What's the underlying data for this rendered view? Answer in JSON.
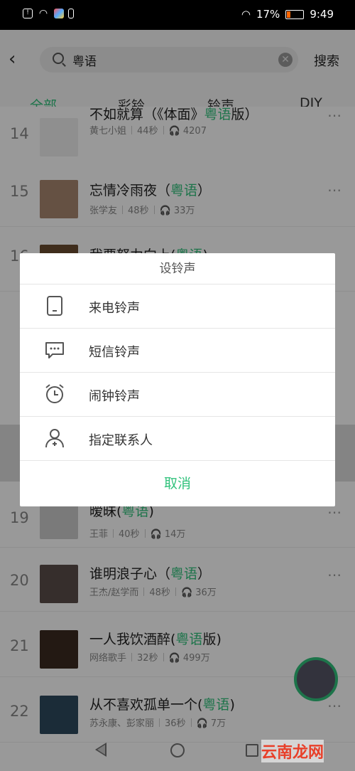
{
  "status_bar": {
    "battery": "17%",
    "time": "9:49"
  },
  "search": {
    "query": "粤语",
    "button": "搜索"
  },
  "tabs": [
    "全部",
    "彩铃",
    "铃声",
    "DIY"
  ],
  "songs": [
    {
      "rank": "14",
      "title_pre": "不如就算（《体面》",
      "title_hl": "粤语",
      "title_post": "版）",
      "artist": "黄七小姐",
      "duration": "44秒",
      "plays": "4207"
    },
    {
      "rank": "15",
      "title_pre": "忘情冷雨夜（",
      "title_hl": "粤语",
      "title_post": "）",
      "artist": "张学友",
      "duration": "48秒",
      "plays": "33万"
    },
    {
      "rank": "16",
      "title_pre": "我要努力向上(",
      "title_hl": "粤语",
      "title_post": ")"
    },
    {
      "rank": "19",
      "title_pre": "暧昧(",
      "title_hl": "粤语",
      "title_post": ")",
      "artist": "王菲",
      "duration": "40秒",
      "plays": "14万"
    },
    {
      "rank": "20",
      "title_pre": "谁明浪子心（",
      "title_hl": "粤语",
      "title_post": "）",
      "artist": "王杰/赵学而",
      "duration": "48秒",
      "plays": "36万"
    },
    {
      "rank": "21",
      "title_pre": "一人我饮酒醉(",
      "title_hl": "粤语",
      "title_post": "版)",
      "artist": "网络歌手",
      "duration": "32秒",
      "plays": "499万"
    },
    {
      "rank": "22",
      "title_pre": "从不喜欢孤单一个(",
      "title_hl": "粤语",
      "title_post": ")",
      "artist": "苏永康、彭家丽",
      "duration": "36秒",
      "plays": "7万"
    }
  ],
  "dialog": {
    "title": "设铃声",
    "options": [
      "来电铃声",
      "短信铃声",
      "闹钟铃声",
      "指定联系人"
    ],
    "cancel": "取消"
  },
  "watermark": "云南龙网",
  "colors": {
    "accent": "#31c27c"
  }
}
